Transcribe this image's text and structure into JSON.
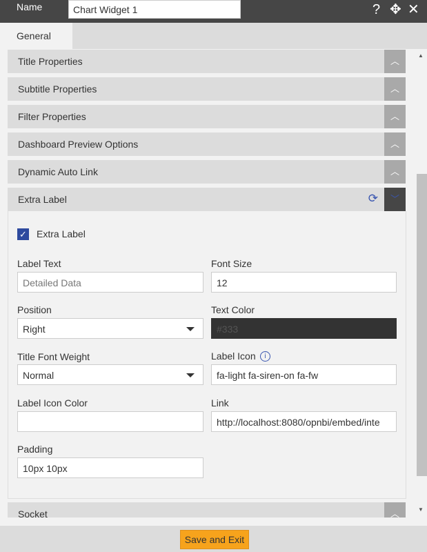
{
  "header": {
    "name_label": "Name",
    "name_value": "Chart Widget 1",
    "help": "?",
    "move": "✥",
    "close": "✕"
  },
  "tabs": [
    {
      "label": "General"
    }
  ],
  "sections": [
    {
      "label": "Title Properties"
    },
    {
      "label": "Subtitle Properties"
    },
    {
      "label": "Filter Properties"
    },
    {
      "label": "Dashboard Preview Options"
    },
    {
      "label": "Dynamic Auto Link"
    },
    {
      "label": "Extra Label"
    },
    {
      "label": "Socket"
    }
  ],
  "extra_label": {
    "checkbox_label": "Extra Label",
    "checked": true,
    "label_text": {
      "label": "Label Text",
      "placeholder": "Detailed Data",
      "value": ""
    },
    "font_size": {
      "label": "Font Size",
      "value": "12"
    },
    "position": {
      "label": "Position",
      "value": "Right"
    },
    "text_color": {
      "label": "Text Color",
      "value": "#333"
    },
    "title_font_weight": {
      "label": "Title Font Weight",
      "value": "Normal"
    },
    "label_icon": {
      "label": "Label Icon",
      "value": "fa-light fa-siren-on fa-fw"
    },
    "label_icon_color": {
      "label": "Label Icon Color",
      "value": ""
    },
    "link": {
      "label": "Link",
      "value": "http://localhost:8080/opnbi/embed/inte"
    },
    "padding": {
      "label": "Padding",
      "value": "10px 10px"
    }
  },
  "footer": {
    "save_label": "Save and Exit"
  },
  "colors": {
    "accent": "#f7a31c",
    "header": "#464646",
    "checkbox": "#2e4a9e"
  }
}
